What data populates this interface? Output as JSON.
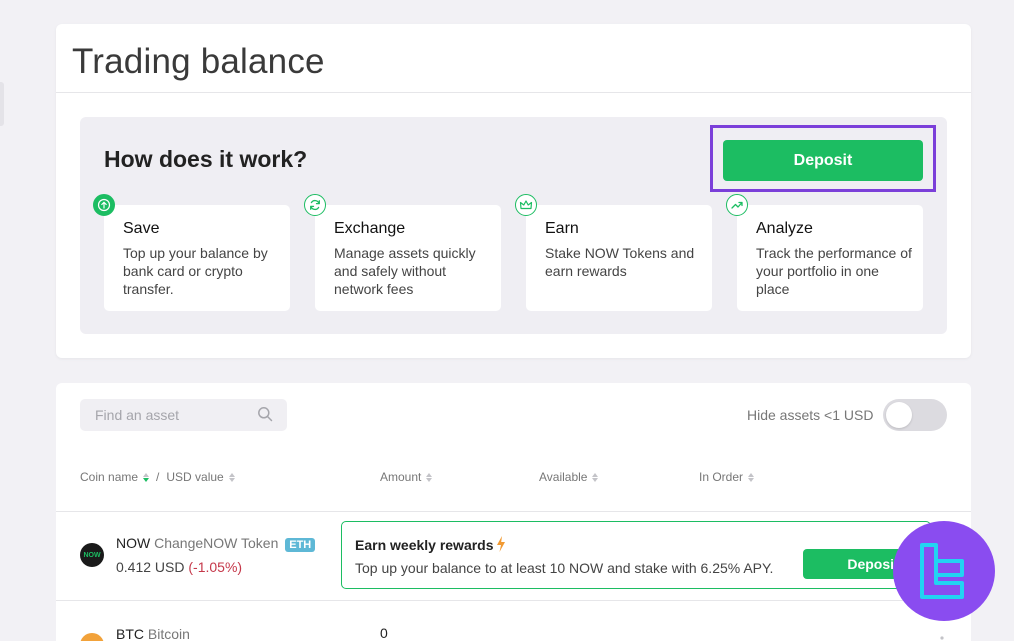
{
  "page": {
    "title": "Trading balance"
  },
  "how": {
    "title": "How does it work?",
    "deposit_label": "Deposit",
    "features": [
      {
        "title": "Save",
        "desc": "Top up your balance by bank card or crypto transfer.",
        "icon": "arrow-up-circle-icon"
      },
      {
        "title": "Exchange",
        "desc": "Manage assets quickly and safely without network fees",
        "icon": "refresh-icon"
      },
      {
        "title": "Earn",
        "desc": "Stake NOW Tokens and earn rewards",
        "icon": "crown-icon"
      },
      {
        "title": "Analyze",
        "desc": "Track the performance of your portfolio in one place",
        "icon": "trend-up-icon"
      }
    ]
  },
  "assets": {
    "search_placeholder": "Find an asset",
    "hide_label": "Hide assets <1 USD",
    "hide_toggle_on": false,
    "columns": {
      "coin_name": "Coin name",
      "sep": "/",
      "usd_value": "USD value",
      "amount": "Amount",
      "available": "Available",
      "in_order": "In Order"
    },
    "rows": [
      {
        "ticker": "NOW",
        "name": "ChangeNOW Token",
        "badge": "ETH",
        "value": "0.412 USD",
        "change": "(-1.05%)",
        "logo_text": "NOW",
        "logo_color": "#1a1a1a"
      },
      {
        "ticker": "BTC",
        "name": "Bitcoin",
        "amount": "0",
        "logo_color": "#f2a23a"
      }
    ],
    "promo": {
      "title": "Earn weekly rewards",
      "desc": "Top up your balance to at least 10 NOW and stake with 6.25% APY.",
      "button": "Deposit"
    }
  },
  "colors": {
    "accent": "#1cbd62",
    "highlight": "#7b3fd9",
    "watermark": "#8a4cf0"
  }
}
